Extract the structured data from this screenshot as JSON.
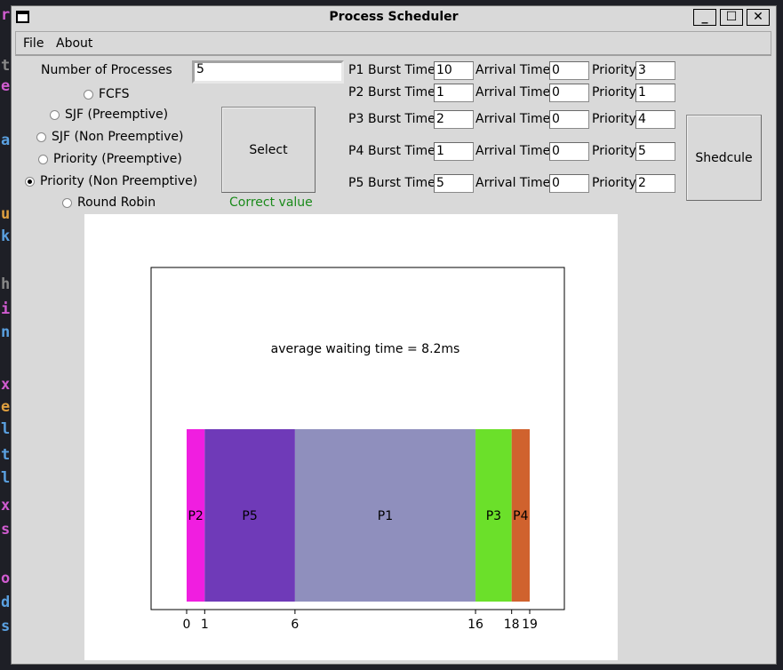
{
  "window": {
    "title": "Process Scheduler"
  },
  "menu": {
    "items": [
      "File",
      "About"
    ]
  },
  "form": {
    "num_processes_label": "Number of Processes",
    "num_processes_value": "5",
    "algorithms": [
      {
        "label": "FCFS",
        "selected": false
      },
      {
        "label": "SJF (Preemptive)",
        "selected": false
      },
      {
        "label": "SJF (Non Preemptive)",
        "selected": false
      },
      {
        "label": "Priority (Preemptive)",
        "selected": false
      },
      {
        "label": "Priority (Non Preemptive)",
        "selected": true
      },
      {
        "label": "Round Robin",
        "selected": false
      }
    ],
    "select_label": "Select",
    "status_text": "Correct value",
    "status_color": "#1a8a1a",
    "schedule_label": "Shedcule",
    "burst_label": "Burst Time",
    "arrival_label": "Arrival Time",
    "priority_label": "Priority",
    "processes": [
      {
        "name": "P1",
        "burst": "10",
        "arrival": "0",
        "priority": "3"
      },
      {
        "name": "P2",
        "burst": "1",
        "arrival": "0",
        "priority": "1"
      },
      {
        "name": "P3",
        "burst": "2",
        "arrival": "0",
        "priority": "4"
      },
      {
        "name": "P4",
        "burst": "1",
        "arrival": "0",
        "priority": "5"
      },
      {
        "name": "P5",
        "burst": "5",
        "arrival": "0",
        "priority": "2"
      }
    ]
  },
  "chart_data": {
    "type": "bar",
    "title": "average waiting time = 8.2ms",
    "orientation": "horizontal-gantt",
    "segments": [
      {
        "label": "P2",
        "start": 0,
        "end": 1,
        "color": "#f01ee0"
      },
      {
        "label": "P5",
        "start": 1,
        "end": 6,
        "color": "#6f3ab8"
      },
      {
        "label": "P1",
        "start": 6,
        "end": 16,
        "color": "#8f8fbd"
      },
      {
        "label": "P3",
        "start": 16,
        "end": 18,
        "color": "#6be02a"
      },
      {
        "label": "P4",
        "start": 18,
        "end": 19,
        "color": "#d0622e"
      }
    ],
    "xticks": [
      "0",
      "1",
      "6",
      "16",
      "18",
      "19"
    ],
    "grid": false
  }
}
